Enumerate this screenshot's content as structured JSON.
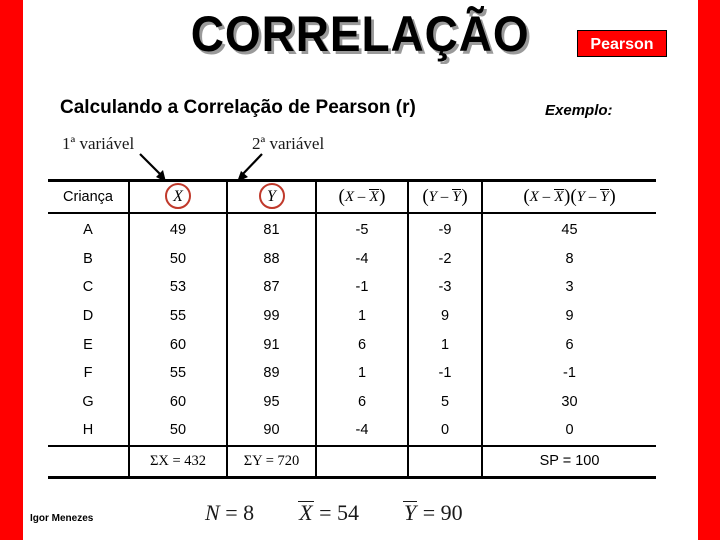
{
  "slide": {
    "title": "CORRELAÇÃO",
    "badge_label": "Pearson",
    "subtitle": "Calculando a Correlação de Pearson (r)",
    "example_label": "Exemplo:",
    "author": "Igor Menezes"
  },
  "annotations": {
    "first_variable": "1ª variável",
    "second_variable": "2ª variável"
  },
  "table": {
    "headers": {
      "subject": "Criança",
      "x": "X",
      "y": "Y",
      "x_dev": "(X – X̄)",
      "y_dev": "(Y – Ȳ)",
      "product": "(X – X̄)(Y – Ȳ)"
    },
    "rows": [
      {
        "subject": "A",
        "x": "49",
        "y": "81",
        "x_dev": "-5",
        "y_dev": "-9",
        "product": "45"
      },
      {
        "subject": "B",
        "x": "50",
        "y": "88",
        "x_dev": "-4",
        "y_dev": "-2",
        "product": "8"
      },
      {
        "subject": "C",
        "x": "53",
        "y": "87",
        "x_dev": "-1",
        "y_dev": "-3",
        "product": "3"
      },
      {
        "subject": "D",
        "x": "55",
        "y": "99",
        "x_dev": "1",
        "y_dev": "9",
        "product": "9"
      },
      {
        "subject": "E",
        "x": "60",
        "y": "91",
        "x_dev": "6",
        "y_dev": "1",
        "product": "6"
      },
      {
        "subject": "F",
        "x": "55",
        "y": "89",
        "x_dev": "1",
        "y_dev": "-1",
        "product": "-1"
      },
      {
        "subject": "G",
        "x": "60",
        "y": "95",
        "x_dev": "6",
        "y_dev": "5",
        "product": "30"
      },
      {
        "subject": "H",
        "x": "50",
        "y": "90",
        "x_dev": "-4",
        "y_dev": "0",
        "product": "0"
      }
    ],
    "totals": {
      "subject": "",
      "x": "ΣX = 432",
      "y": "ΣY = 720",
      "x_dev": "",
      "y_dev": "",
      "product": "SP = 100"
    }
  },
  "formulas": {
    "n_label": "N",
    "n_value": "= 8",
    "xbar_label": "X",
    "xbar_value": "= 54",
    "ybar_label": "Y",
    "ybar_value": "= 90"
  },
  "colors": {
    "accent_red": "#FF0000",
    "circle_red": "#C0392B",
    "title_shadow": "#9a9a9a"
  }
}
